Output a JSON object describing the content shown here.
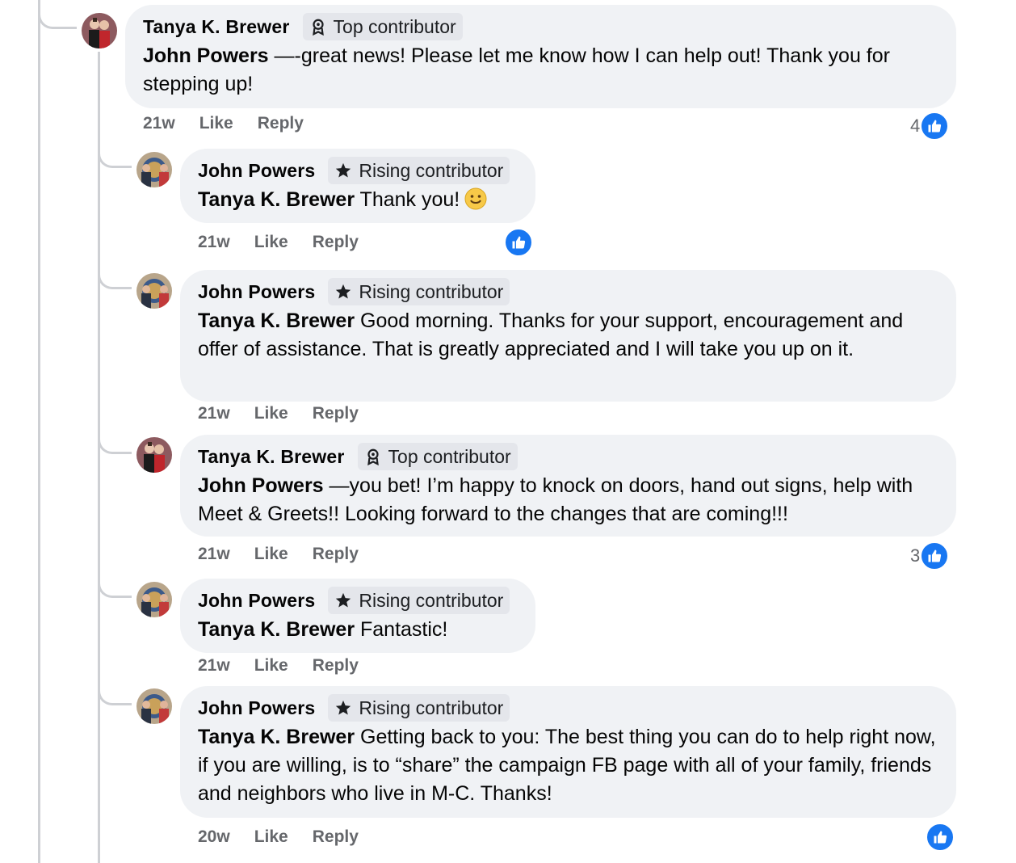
{
  "comments": [
    {
      "author": "Tanya K. Brewer",
      "badge": "Top contributor",
      "badge_icon": "top-contributor-icon",
      "mention": "John Powers",
      "body": " —-great news! Please let me know how I can help out! Thank you for stepping up!",
      "time": "21w",
      "like": "Like",
      "reply": "Reply",
      "reaction_count": "4"
    },
    {
      "author": "John Powers",
      "badge": "Rising contributor",
      "badge_icon": "star-icon",
      "mention": "Tanya K. Brewer",
      "body": " Thank you!",
      "time": "21w",
      "like": "Like",
      "reply": "Reply",
      "reaction_count": ""
    },
    {
      "author": "John Powers",
      "badge": "Rising contributor",
      "badge_icon": "star-icon",
      "mention": "Tanya K. Brewer",
      "body": " Good morning. Thanks for your support, encouragement and offer of assistance. That is greatly appreciated and I will take you up on it.",
      "time": "21w",
      "like": "Like",
      "reply": "Reply",
      "reaction_count": ""
    },
    {
      "author": "Tanya K. Brewer",
      "badge": "Top contributor",
      "badge_icon": "top-contributor-icon",
      "mention": "John Powers",
      "body": " —you bet! I’m happy to knock on doors, hand out signs, help with Meet & Greets!! Looking forward to the changes that are coming!!!",
      "time": "21w",
      "like": "Like",
      "reply": "Reply",
      "reaction_count": "3"
    },
    {
      "author": "John Powers",
      "badge": "Rising contributor",
      "badge_icon": "star-icon",
      "mention": "Tanya K. Brewer",
      "body": " Fantastic!",
      "time": "21w",
      "like": "Like",
      "reply": "Reply",
      "reaction_count": ""
    },
    {
      "author": "John Powers",
      "badge": "Rising contributor",
      "badge_icon": "star-icon",
      "mention": "Tanya K. Brewer",
      "body": " Getting back to you: The best thing you can do to help right now, if you are willing, is to “share” the campaign FB page with all of your family, friends and neighbors who live in M-C. Thanks!",
      "time": "20w",
      "like": "Like",
      "reply": "Reply",
      "reaction_count": ""
    }
  ],
  "colors": {
    "bubble": "#f0f2f5",
    "badge": "#e4e6eb",
    "like_blue": "#1877f2",
    "meta_gray": "#65676b"
  }
}
